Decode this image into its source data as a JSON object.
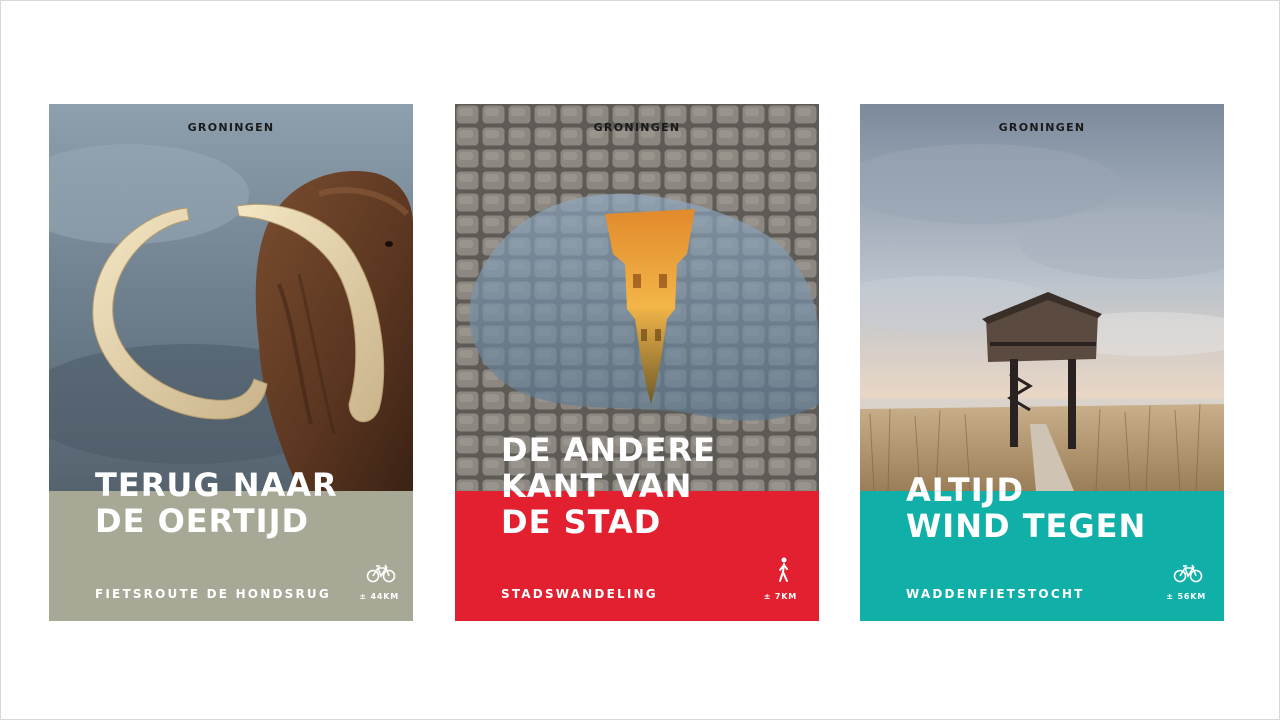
{
  "posters": [
    {
      "brand": "GRONINGEN",
      "headline": [
        "TERUG NAAR",
        "DE OERTIJD"
      ],
      "route": "FIETSROUTE DE HONDSRUG",
      "distance": "± 44KM",
      "mode_icon": "bicycle-icon",
      "band_color": "#a8a896"
    },
    {
      "brand": "GRONINGEN",
      "headline": [
        "DE ANDERE",
        "KANT VAN",
        "DE STAD"
      ],
      "route": "STADSWANDELING",
      "distance": "± 7KM",
      "mode_icon": "walking-person-icon",
      "band_color": "#e3202f"
    },
    {
      "brand": "GRONINGEN",
      "headline": [
        "ALTIJD",
        "WIND TEGEN"
      ],
      "route": "WADDENFIETSTOCHT",
      "distance": "± 56KM",
      "mode_icon": "bicycle-icon",
      "band_color": "#10b0a8"
    }
  ]
}
